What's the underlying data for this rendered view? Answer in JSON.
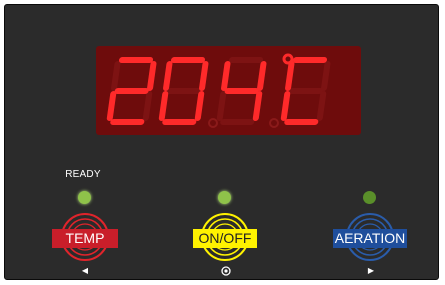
{
  "display": {
    "reading": "20.4°C"
  },
  "ready_label": "READY",
  "indicators": [
    {
      "name": "ready-led",
      "color": "#8fc24a"
    },
    {
      "name": "onoff-led",
      "color": "#8fc24a"
    },
    {
      "name": "aeration-led",
      "color": "#5a8f2a"
    }
  ],
  "buttons": [
    {
      "label": "TEMP",
      "ring_color": "#e0242b",
      "label_bg": "#c91e2a",
      "label_text_color": "#ffffff"
    },
    {
      "label": "ON/OFF",
      "ring_color": "#fff200",
      "label_bg": "#fff200",
      "label_text_color": "#222222"
    },
    {
      "label": "AERATION",
      "ring_color": "#2a5caa",
      "label_bg": "#1f4e9c",
      "label_text_color": "#ffffff"
    }
  ],
  "button_icons": [
    "left-arrow-icon",
    "circle-dot-icon",
    "right-arrow-icon"
  ],
  "colors": {
    "panel": "#2b2b2b",
    "display_bg": "#6e0c0c",
    "segment_on": "#ff2a2a"
  }
}
